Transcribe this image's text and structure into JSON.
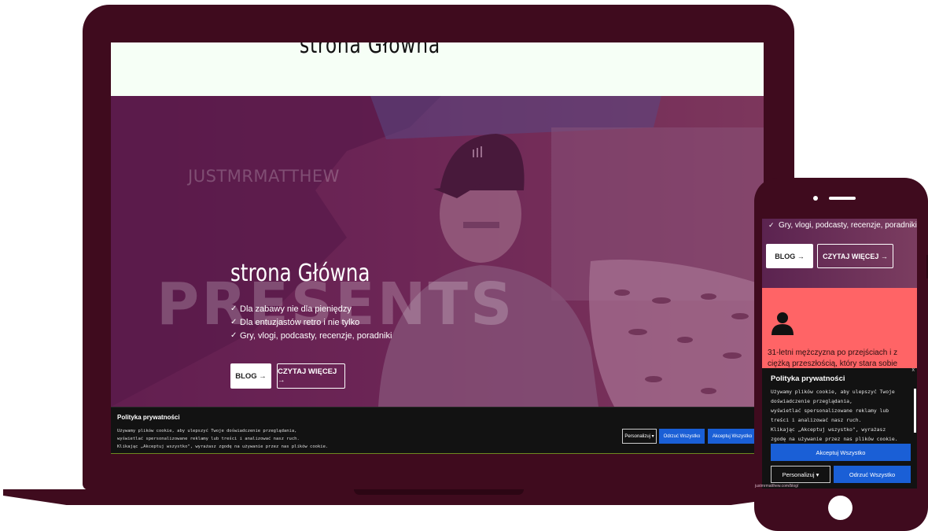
{
  "laptop": {
    "header_title": "strona Główna",
    "hero": {
      "kicker": "JUSTMRMATTHEW",
      "watermark": "PRESENTS",
      "title": "strona Główna",
      "list": [
        "Dla zabawy nie dla pieniędzy",
        "Dla entuzjastów retro i nie tylko",
        "Gry, vlogi, podcasty, recenzje, poradniki"
      ],
      "blog_button": "BLOG →",
      "more_button": "CZYTAJ WIĘCEJ →"
    },
    "cookie": {
      "title": "Polityka prywatności",
      "text": "Używamy plików cookie, aby ulepszyć Twoje doświadczenie przeglądania,\nwyświetlać spersonalizowane reklamy lub treści i analizować nasz ruch.\nKlikając „Akceptuj wszystko\", wyrażasz zgodę na używanie przez nas plików cookie.",
      "close": "x",
      "personalize": "Personalizuj ▾",
      "reject": "Odrzuć Wszystko",
      "accept": "Akceptuj Wszystko"
    }
  },
  "phone": {
    "list_item": "Gry, vlogi, podcasty, recenzje, poradniki",
    "blog_button": "BLOG →",
    "more_button": "CZYTAJ WIĘCEJ →",
    "card_text": "31-letni mężczyzna po przejściach i z ciężką przeszłością, który stara sobie jakoś radzić...",
    "cookie": {
      "title": "Polityka prywatności",
      "text": "Używamy plików cookie, aby ulepszyć Twoje\ndoświadczenie przeglądania,\nwyświetlać spersonalizowane reklamy lub\ntreści i analizować nasz ruch.\nKlikając „Akceptuj wszystko\", wyrażasz\nzgodę na używanie przez nas plików cookie.",
      "close": "x",
      "accept": "Akceptuj Wszystko",
      "personalize": "Personalizuj  ▾",
      "reject": "Odrzuć Wszystko"
    },
    "url": "justmrmatthew.com/blog/"
  },
  "colors": {
    "device_frame": "#3f0b1e",
    "hero_overlay": "#6c2056",
    "accent_blue": "#1a5fd6",
    "card_red": "#ff6466",
    "cookie_bg": "#121212"
  }
}
